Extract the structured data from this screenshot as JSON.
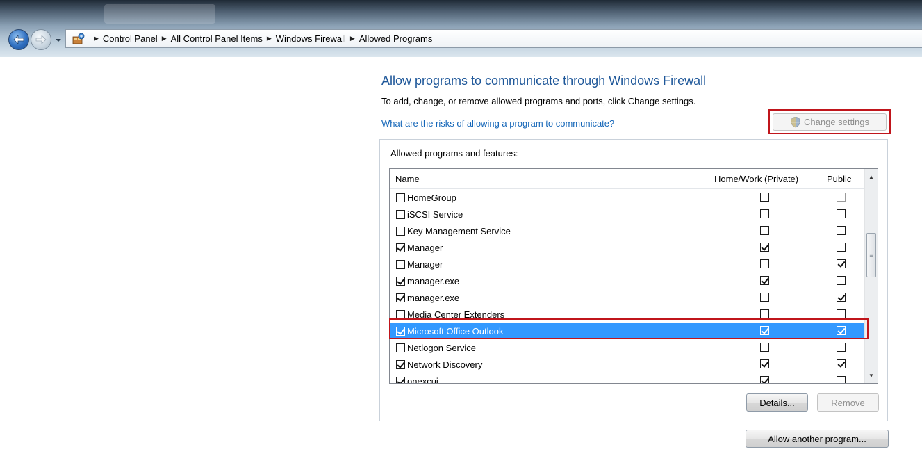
{
  "address_bar": {
    "breadcrumbs": [
      "Control Panel",
      "All Control Panel Items",
      "Windows Firewall",
      "Allowed Programs"
    ]
  },
  "main": {
    "title": "Allow programs to communicate through Windows Firewall",
    "description": "To add, change, or remove allowed programs and ports, click Change settings.",
    "risk_link": "What are the risks of allowing a program to communicate?",
    "change_settings_label": "Change settings"
  },
  "programs": {
    "group_label": "Allowed programs and features:",
    "columns": {
      "name": "Name",
      "private": "Home/Work (Private)",
      "public": "Public"
    },
    "rows": [
      {
        "name": "HomeGroup",
        "enabled": false,
        "private": false,
        "public": false
      },
      {
        "name": "iSCSI Service",
        "enabled": false,
        "private": false,
        "public": false
      },
      {
        "name": "Key Management Service",
        "enabled": false,
        "private": false,
        "public": false
      },
      {
        "name": "Manager",
        "enabled": true,
        "private": true,
        "public": false
      },
      {
        "name": "Manager",
        "enabled": false,
        "private": false,
        "public": true
      },
      {
        "name": "manager.exe",
        "enabled": true,
        "private": true,
        "public": false
      },
      {
        "name": "manager.exe",
        "enabled": true,
        "private": false,
        "public": true
      },
      {
        "name": "Media Center Extenders",
        "enabled": false,
        "private": false,
        "public": false
      },
      {
        "name": "Microsoft Office Outlook",
        "enabled": true,
        "private": true,
        "public": true,
        "selected": true
      },
      {
        "name": "Netlogon Service",
        "enabled": false,
        "private": false,
        "public": false
      },
      {
        "name": "Network Discovery",
        "enabled": true,
        "private": true,
        "public": true
      },
      {
        "name": "onexcui",
        "enabled": true,
        "private": true,
        "public": false
      }
    ],
    "details_label": "Details...",
    "remove_label": "Remove",
    "allow_another_label": "Allow another program..."
  },
  "colors": {
    "title_blue": "#1e5799",
    "link_blue": "#1466b8",
    "selection": "#3399ff",
    "highlight_red": "#c0151b"
  },
  "icons": {
    "back": "back-arrow-icon",
    "forward": "forward-arrow-icon",
    "address": "control-panel-icon",
    "shield": "uac-shield-icon"
  }
}
